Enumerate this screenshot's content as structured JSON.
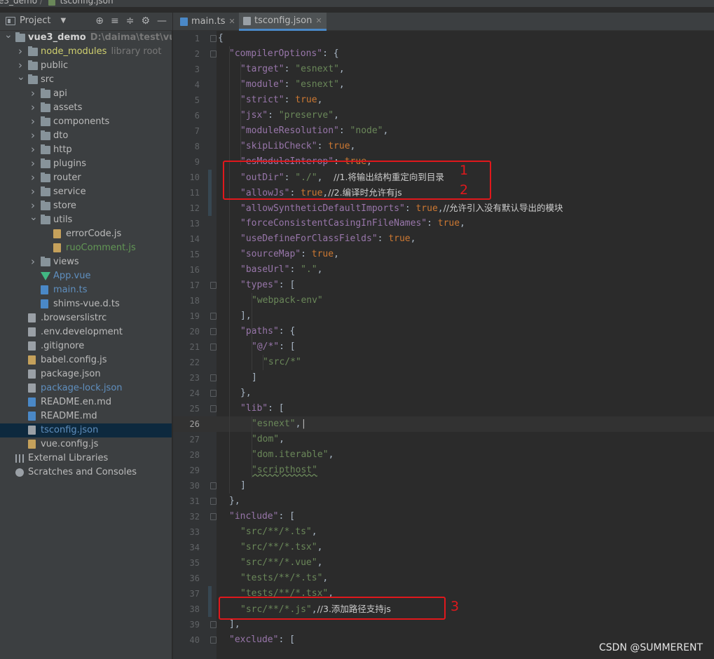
{
  "breadcrumb": {
    "project": "e3_demo",
    "file": "tsconfig.json"
  },
  "project_panel": {
    "title": "Project",
    "tools": [
      "⊕",
      "≡",
      "≑",
      "⚙",
      "—"
    ]
  },
  "tree": [
    {
      "depth": 0,
      "arrow": "open",
      "icon": "folder",
      "name": "vue3_demo",
      "extra": "D:\\daima\\test\\vue3_de",
      "bold": true
    },
    {
      "depth": 1,
      "arrow": "closed",
      "icon": "folder",
      "name": "node_modules",
      "extra": "library root",
      "color": "yellow"
    },
    {
      "depth": 1,
      "arrow": "closed",
      "icon": "folder",
      "name": "public"
    },
    {
      "depth": 1,
      "arrow": "open",
      "icon": "folder",
      "name": "src"
    },
    {
      "depth": 2,
      "arrow": "closed",
      "icon": "folder",
      "name": "api"
    },
    {
      "depth": 2,
      "arrow": "closed",
      "icon": "folder",
      "name": "assets"
    },
    {
      "depth": 2,
      "arrow": "closed",
      "icon": "folder",
      "name": "components"
    },
    {
      "depth": 2,
      "arrow": "closed",
      "icon": "folder",
      "name": "dto"
    },
    {
      "depth": 2,
      "arrow": "closed",
      "icon": "folder",
      "name": "http"
    },
    {
      "depth": 2,
      "arrow": "closed",
      "icon": "folder",
      "name": "plugins"
    },
    {
      "depth": 2,
      "arrow": "closed",
      "icon": "folder",
      "name": "router"
    },
    {
      "depth": 2,
      "arrow": "closed",
      "icon": "folder",
      "name": "service"
    },
    {
      "depth": 2,
      "arrow": "closed",
      "icon": "folder",
      "name": "store"
    },
    {
      "depth": 2,
      "arrow": "open",
      "icon": "folder",
      "name": "utils"
    },
    {
      "depth": 3,
      "arrow": "none",
      "icon": "js",
      "name": "errorCode.js"
    },
    {
      "depth": 3,
      "arrow": "none",
      "icon": "js",
      "name": "ruoComment.js",
      "color": "green"
    },
    {
      "depth": 2,
      "arrow": "closed",
      "icon": "folder",
      "name": "views"
    },
    {
      "depth": 2,
      "arrow": "none",
      "icon": "vue",
      "name": "App.vue",
      "color": "blue"
    },
    {
      "depth": 2,
      "arrow": "none",
      "icon": "ts",
      "name": "main.ts",
      "color": "blue"
    },
    {
      "depth": 2,
      "arrow": "none",
      "icon": "ts",
      "name": "shims-vue.d.ts"
    },
    {
      "depth": 1,
      "arrow": "none",
      "icon": "txt",
      "name": ".browserslistrc"
    },
    {
      "depth": 1,
      "arrow": "none",
      "icon": "txt",
      "name": ".env.development"
    },
    {
      "depth": 1,
      "arrow": "none",
      "icon": "txt",
      "name": ".gitignore"
    },
    {
      "depth": 1,
      "arrow": "none",
      "icon": "js",
      "name": "babel.config.js"
    },
    {
      "depth": 1,
      "arrow": "none",
      "icon": "json",
      "name": "package.json"
    },
    {
      "depth": 1,
      "arrow": "none",
      "icon": "json",
      "name": "package-lock.json",
      "color": "blue"
    },
    {
      "depth": 1,
      "arrow": "none",
      "icon": "md",
      "name": "README.en.md"
    },
    {
      "depth": 1,
      "arrow": "none",
      "icon": "md",
      "name": "README.md"
    },
    {
      "depth": 1,
      "arrow": "none",
      "icon": "json",
      "name": "tsconfig.json",
      "color": "blue",
      "selected": true
    },
    {
      "depth": 1,
      "arrow": "none",
      "icon": "js",
      "name": "vue.config.js"
    },
    {
      "depth": 0,
      "arrow": "none",
      "icon": "lib",
      "name": "External Libraries"
    },
    {
      "depth": 0,
      "arrow": "none",
      "icon": "scr",
      "name": "Scratches and Consoles"
    }
  ],
  "tabs": [
    {
      "label": "main.ts",
      "icon": "ts",
      "active": false
    },
    {
      "label": "tsconfig.json",
      "icon": "json",
      "active": true
    }
  ],
  "editor": {
    "current_line": 26,
    "lines": [
      {
        "n": 1,
        "indent": 0,
        "parts": [
          [
            "p",
            "{"
          ]
        ]
      },
      {
        "n": 2,
        "indent": 1,
        "parts": [
          [
            "k",
            "\"compilerOptions\""
          ],
          [
            "p",
            ": {"
          ]
        ]
      },
      {
        "n": 3,
        "indent": 2,
        "parts": [
          [
            "k",
            "\"target\""
          ],
          [
            "p",
            ": "
          ],
          [
            "s",
            "\"esnext\""
          ],
          [
            "p",
            ","
          ]
        ]
      },
      {
        "n": 4,
        "indent": 2,
        "parts": [
          [
            "k",
            "\"module\""
          ],
          [
            "p",
            ": "
          ],
          [
            "s",
            "\"esnext\""
          ],
          [
            "p",
            ","
          ]
        ]
      },
      {
        "n": 5,
        "indent": 2,
        "parts": [
          [
            "k",
            "\"strict\""
          ],
          [
            "p",
            ": "
          ],
          [
            "kw",
            "true"
          ],
          [
            "p",
            ","
          ]
        ]
      },
      {
        "n": 6,
        "indent": 2,
        "parts": [
          [
            "k",
            "\"jsx\""
          ],
          [
            "p",
            ": "
          ],
          [
            "s",
            "\"preserve\""
          ],
          [
            "p",
            ","
          ]
        ]
      },
      {
        "n": 7,
        "indent": 2,
        "parts": [
          [
            "k",
            "\"moduleResolution\""
          ],
          [
            "p",
            ": "
          ],
          [
            "s",
            "\"node\""
          ],
          [
            "p",
            ","
          ]
        ]
      },
      {
        "n": 8,
        "indent": 2,
        "parts": [
          [
            "k",
            "\"skipLibCheck\""
          ],
          [
            "p",
            ": "
          ],
          [
            "kw",
            "true"
          ],
          [
            "p",
            ","
          ]
        ]
      },
      {
        "n": 9,
        "indent": 2,
        "parts": [
          [
            "k",
            "\"esModuleInterop\""
          ],
          [
            "p",
            ": "
          ],
          [
            "kw",
            "true"
          ],
          [
            "p",
            ","
          ]
        ]
      },
      {
        "n": 10,
        "indent": 2,
        "parts": [
          [
            "k",
            "\"outDir\""
          ],
          [
            "p",
            ": "
          ],
          [
            "s",
            "\"./\""
          ],
          [
            "p",
            ",  "
          ],
          [
            "cm",
            "//1.将输出结构重定向到目录"
          ]
        ]
      },
      {
        "n": 11,
        "indent": 2,
        "parts": [
          [
            "k",
            "\"allowJs\""
          ],
          [
            "p",
            ": "
          ],
          [
            "kw",
            "true"
          ],
          [
            "p",
            ","
          ],
          [
            "cm",
            "//2.编译时允许有js"
          ]
        ]
      },
      {
        "n": 12,
        "indent": 2,
        "parts": [
          [
            "k",
            "\"allowSyntheticDefaultImports\""
          ],
          [
            "p",
            ": "
          ],
          [
            "kw",
            "true"
          ],
          [
            "p",
            ","
          ],
          [
            "cm",
            "//允许引入没有默认导出的模块"
          ]
        ]
      },
      {
        "n": 13,
        "indent": 2,
        "parts": [
          [
            "k",
            "\"forceConsistentCasingInFileNames\""
          ],
          [
            "p",
            ": "
          ],
          [
            "kw",
            "true"
          ],
          [
            "p",
            ","
          ]
        ]
      },
      {
        "n": 14,
        "indent": 2,
        "parts": [
          [
            "k",
            "\"useDefineForClassFields\""
          ],
          [
            "p",
            ": "
          ],
          [
            "kw",
            "true"
          ],
          [
            "p",
            ","
          ]
        ]
      },
      {
        "n": 15,
        "indent": 2,
        "parts": [
          [
            "k",
            "\"sourceMap\""
          ],
          [
            "p",
            ": "
          ],
          [
            "kw",
            "true"
          ],
          [
            "p",
            ","
          ]
        ]
      },
      {
        "n": 16,
        "indent": 2,
        "parts": [
          [
            "k",
            "\"baseUrl\""
          ],
          [
            "p",
            ": "
          ],
          [
            "s",
            "\".\""
          ],
          [
            "p",
            ","
          ]
        ]
      },
      {
        "n": 17,
        "indent": 2,
        "parts": [
          [
            "k",
            "\"types\""
          ],
          [
            "p",
            ": ["
          ]
        ]
      },
      {
        "n": 18,
        "indent": 3,
        "parts": [
          [
            "s",
            "\"webpack-env\""
          ]
        ]
      },
      {
        "n": 19,
        "indent": 2,
        "parts": [
          [
            "p",
            "],"
          ]
        ]
      },
      {
        "n": 20,
        "indent": 2,
        "parts": [
          [
            "k",
            "\"paths\""
          ],
          [
            "p",
            ": {"
          ]
        ]
      },
      {
        "n": 21,
        "indent": 3,
        "parts": [
          [
            "k",
            "\"@/*\""
          ],
          [
            "p",
            ": ["
          ]
        ]
      },
      {
        "n": 22,
        "indent": 4,
        "parts": [
          [
            "s",
            "\"src/*\""
          ]
        ]
      },
      {
        "n": 23,
        "indent": 3,
        "parts": [
          [
            "p",
            "]"
          ]
        ]
      },
      {
        "n": 24,
        "indent": 2,
        "parts": [
          [
            "p",
            "},"
          ]
        ]
      },
      {
        "n": 25,
        "indent": 2,
        "parts": [
          [
            "k",
            "\"lib\""
          ],
          [
            "p",
            ": ["
          ]
        ]
      },
      {
        "n": 26,
        "indent": 3,
        "parts": [
          [
            "s",
            "\"esnext\""
          ],
          [
            "p",
            ","
          ]
        ]
      },
      {
        "n": 27,
        "indent": 3,
        "parts": [
          [
            "s",
            "\"dom\""
          ],
          [
            "p",
            ","
          ]
        ]
      },
      {
        "n": 28,
        "indent": 3,
        "parts": [
          [
            "s",
            "\"dom.iterable\""
          ],
          [
            "p",
            ","
          ]
        ]
      },
      {
        "n": 29,
        "indent": 3,
        "parts": [
          [
            "s",
            "\"scripthost\""
          ]
        ]
      },
      {
        "n": 30,
        "indent": 2,
        "parts": [
          [
            "p",
            "]"
          ]
        ]
      },
      {
        "n": 31,
        "indent": 1,
        "parts": [
          [
            "p",
            "},"
          ]
        ]
      },
      {
        "n": 32,
        "indent": 1,
        "parts": [
          [
            "k",
            "\"include\""
          ],
          [
            "p",
            ": ["
          ]
        ]
      },
      {
        "n": 33,
        "indent": 2,
        "parts": [
          [
            "s",
            "\"src/**/*.ts\""
          ],
          [
            "p",
            ","
          ]
        ]
      },
      {
        "n": 34,
        "indent": 2,
        "parts": [
          [
            "s",
            "\"src/**/*.tsx\""
          ],
          [
            "p",
            ","
          ]
        ]
      },
      {
        "n": 35,
        "indent": 2,
        "parts": [
          [
            "s",
            "\"src/**/*.vue\""
          ],
          [
            "p",
            ","
          ]
        ]
      },
      {
        "n": 36,
        "indent": 2,
        "parts": [
          [
            "s",
            "\"tests/**/*.ts\""
          ],
          [
            "p",
            ","
          ]
        ]
      },
      {
        "n": 37,
        "indent": 2,
        "parts": [
          [
            "s",
            "\"tests/**/*.tsx\""
          ],
          [
            "p",
            ","
          ]
        ]
      },
      {
        "n": 38,
        "indent": 2,
        "parts": [
          [
            "s",
            "\"src/**/*.js\""
          ],
          [
            "p",
            ","
          ],
          [
            "cm",
            "//3.添加路径支持js"
          ]
        ]
      },
      {
        "n": 39,
        "indent": 1,
        "parts": [
          [
            "p",
            "],"
          ]
        ]
      },
      {
        "n": 40,
        "indent": 1,
        "parts": [
          [
            "k",
            "\"exclude\""
          ],
          [
            "p",
            ": ["
          ]
        ]
      }
    ]
  },
  "annotations": [
    "1",
    "2",
    "3"
  ],
  "watermark": "CSDN @SUMMERENT"
}
